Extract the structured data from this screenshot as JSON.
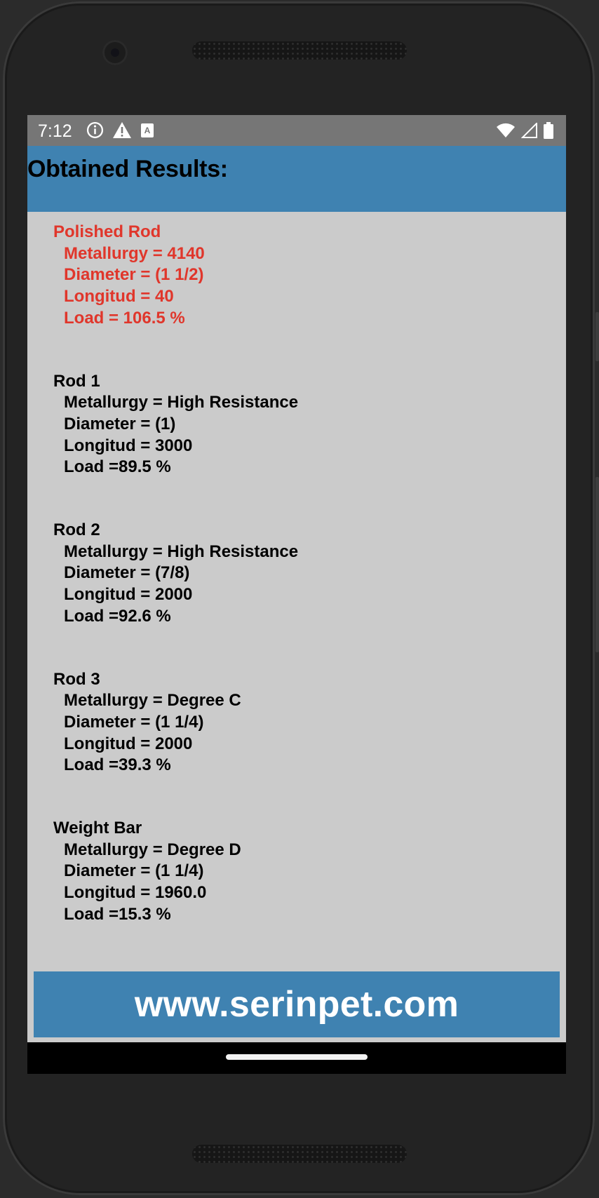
{
  "statusbar": {
    "time": "7:12",
    "left_icons": [
      "info-icon",
      "warning-icon",
      "keyboard-a-icon"
    ],
    "right_icons": [
      "wifi-icon",
      "cell-signal-icon",
      "battery-icon"
    ]
  },
  "header": {
    "title": "Obtained Results:"
  },
  "colors": {
    "accent": "#3f82b1",
    "background": "#cbcbcb",
    "highlight": "#e0362b",
    "statusbar": "#767676"
  },
  "results": [
    {
      "title": "Polished Rod",
      "metallurgy": "Metallurgy = 4140",
      "diameter": "Diameter = (1 1/2)",
      "longitud": "Longitud = 40",
      "load": "Load = 106.5 %"
    },
    {
      "title": "Rod 1",
      "metallurgy": "Metallurgy = High Resistance",
      "diameter": "Diameter = (1)",
      "longitud": "Longitud = 3000",
      "load": "Load =89.5 %"
    },
    {
      "title": "Rod 2",
      "metallurgy": "Metallurgy = High Resistance",
      "diameter": "Diameter = (7/8)",
      "longitud": "Longitud = 2000",
      "load": "Load =92.6 %"
    },
    {
      "title": "Rod 3",
      "metallurgy": "Metallurgy = Degree C",
      "diameter": "Diameter = (1 1/4)",
      "longitud": "Longitud = 2000",
      "load": "Load =39.3 %"
    },
    {
      "title": "Weight Bar",
      "metallurgy": "Metallurgy = Degree D",
      "diameter": "Diameter = (1 1/4)",
      "longitud": "Longitud = 1960.0",
      "load": "Load =15.3 %"
    }
  ],
  "footer": {
    "link": "www.serinpet.com"
  }
}
